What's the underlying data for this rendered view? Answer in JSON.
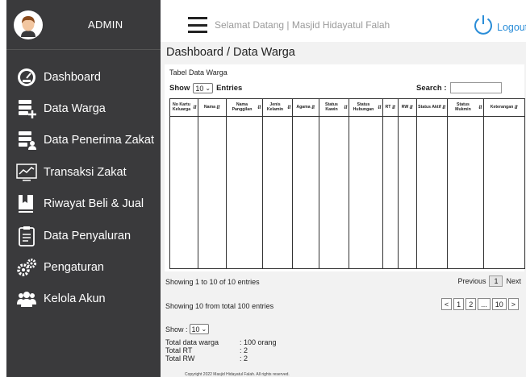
{
  "sidebar": {
    "admin_name": "ADMIN",
    "items": [
      {
        "label": "Dashboard",
        "icon": "dashboard-gauge-icon"
      },
      {
        "label": "Data Warga",
        "icon": "database-add-icon"
      },
      {
        "label": "Data Penerima Zakat",
        "icon": "database-user-icon"
      },
      {
        "label": "Transaksi Zakat",
        "icon": "chart-monitor-icon"
      },
      {
        "label": "Riwayat Beli & Jual",
        "icon": "book-icon"
      },
      {
        "label": "Data Penyaluran",
        "icon": "clipboard-icon"
      },
      {
        "label": "Pengaturan",
        "icon": "gears-icon"
      },
      {
        "label": "Kelola Akun",
        "icon": "users-icon"
      }
    ]
  },
  "header": {
    "welcome": "Selamat Datang | Masjid Hidayatul Falah",
    "logout_label": "Logout"
  },
  "main": {
    "breadcrumb": "Dashboard / Data Warga",
    "table_title": "Tabel Data Warga",
    "show_label": "Show",
    "entries_value": "10",
    "entries_label": "Entries",
    "search_label": "Search :",
    "columns": [
      "No Kartu Keluarga",
      "Nama",
      "Nama Panggilan",
      "Jenis Kelamin",
      "Agama",
      "Status Kawin",
      "Status Hubungan",
      "RT",
      "RW",
      "Status Aktif",
      "Status Mukmin",
      "Keterangan"
    ],
    "info_entries": "Showing 1 to 10 of 10 entries",
    "pager_top": {
      "previous": "Previous",
      "current": "1",
      "next": "Next"
    },
    "info_total": "Showing 10 from total 100 entries",
    "pager_bottom": [
      "<",
      "1",
      "2",
      "...",
      "10",
      ">"
    ],
    "show2_label": "Show :",
    "show2_value": "10",
    "totals": [
      {
        "label": "Total data warga",
        "value": ": 100 orang"
      },
      {
        "label": "Total RT",
        "value": ": 2"
      },
      {
        "label": "Total RW",
        "value": ": 2"
      }
    ],
    "footer": "Copyright   2022 Masjid Hidayatul Falah. All rights reserved."
  }
}
